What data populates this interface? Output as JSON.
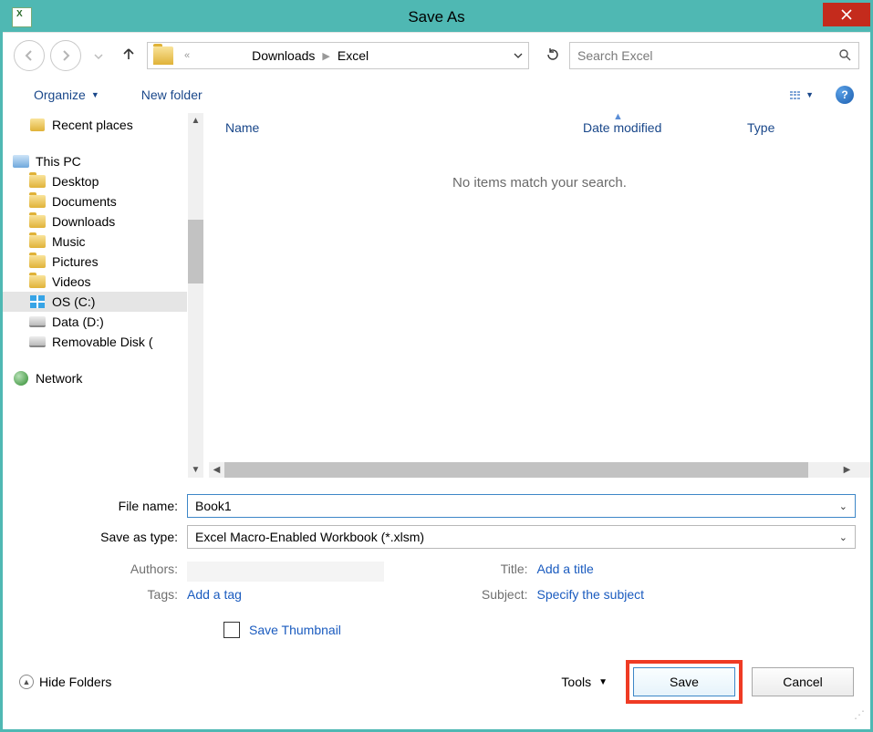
{
  "titlebar": {
    "title": "Save As"
  },
  "nav": {
    "path": {
      "seg1": "Downloads",
      "seg2": "Excel"
    },
    "search_placeholder": "Search Excel"
  },
  "toolbar": {
    "organize": "Organize",
    "newfolder": "New folder"
  },
  "tree": {
    "recent": "Recent places",
    "thispc": "This PC",
    "desktop": "Desktop",
    "documents": "Documents",
    "downloads": "Downloads",
    "music": "Music",
    "pictures": "Pictures",
    "videos": "Videos",
    "osc": "OS (C:)",
    "datad": "Data (D:)",
    "remov": "Removable Disk (",
    "network": "Network"
  },
  "columns": {
    "name": "Name",
    "date": "Date modified",
    "type": "Type"
  },
  "empty": "No items match your search.",
  "form": {
    "filename_label": "File name:",
    "filename_value": "Book1",
    "type_label": "Save as type:",
    "type_value": "Excel Macro-Enabled Workbook (*.xlsm)",
    "authors_label": "Authors:",
    "tags_label": "Tags:",
    "tags_value": "Add a tag",
    "title_label": "Title:",
    "title_value": "Add a title",
    "subject_label": "Subject:",
    "subject_value": "Specify the subject",
    "savethumb": "Save Thumbnail"
  },
  "footer": {
    "hidefolders": "Hide Folders",
    "tools": "Tools",
    "save": "Save",
    "cancel": "Cancel"
  }
}
